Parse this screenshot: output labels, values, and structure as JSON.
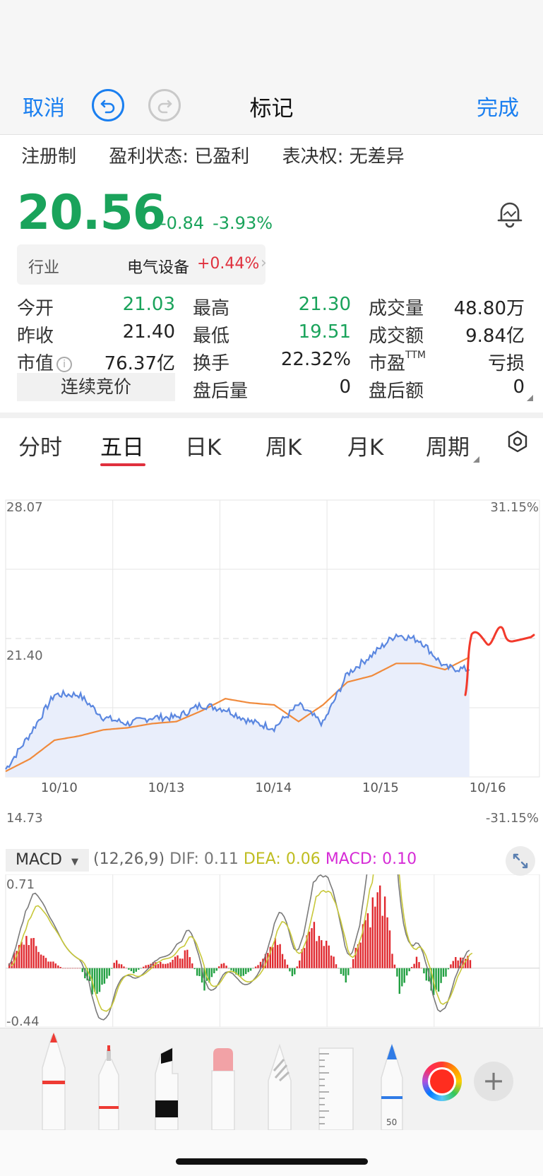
{
  "nav": {
    "cancel": "取消",
    "title": "标记",
    "done": "完成",
    "undo_icon": "undo-icon",
    "redo_icon": "redo-icon"
  },
  "badges": [
    "注册制",
    "盈利状态: 已盈利",
    "表决权: 无差异"
  ],
  "quote": {
    "price": "20.56",
    "change": "-0.84",
    "change_pct": "-3.93%",
    "alert_icon": "bell-icon"
  },
  "industry": {
    "label": "行业",
    "name": "电气设备",
    "change": "+0.44%"
  },
  "stats": {
    "open_label": "今开",
    "open": "21.03",
    "high_label": "最高",
    "high": "21.30",
    "volume_label": "成交量",
    "volume": "48.80万",
    "prev_close_label": "昨收",
    "prev_close": "21.40",
    "low_label": "最低",
    "low": "19.51",
    "turnover_label": "成交额",
    "turnover": "9.84亿",
    "mktcap_label": "市值",
    "mktcap": "76.37亿",
    "turnover_rate_label": "换手",
    "turnover_rate": "22.32%",
    "pe_label": "市盈",
    "pe_sup": "TTM",
    "pe": "亏损",
    "auction_label": "连续竞价",
    "after_vol_label": "盘后量",
    "after_vol": "0",
    "after_amt_label": "盘后额",
    "after_amt": "0"
  },
  "tabs": [
    "分时",
    "五日",
    "日K",
    "周K",
    "月K",
    "周期"
  ],
  "active_tab": "五日",
  "chart_data": [
    {
      "type": "line",
      "x": [
        "10/10",
        "10/13",
        "10/14",
        "10/15",
        "10/16"
      ],
      "ylim": [
        14.73,
        28.07
      ],
      "reference_line": 21.4,
      "left_axis_labels": [
        "28.07",
        "21.40",
        "14.73"
      ],
      "right_axis_labels": [
        "31.15%",
        "-31.15%"
      ],
      "series": [
        {
          "values": [
            15.1,
            16.8,
            18.7,
            18.7,
            17.6,
            17.3,
            17.6,
            17.6,
            18.2,
            18.0,
            17.4,
            17.1,
            18.2,
            17.3,
            19.7,
            20.6,
            21.6,
            21.3,
            20.0,
            19.9
          ]
        },
        {
          "values": [
            15.0,
            15.6,
            16.5,
            16.7,
            17.0,
            17.1,
            17.3,
            17.4,
            17.9,
            18.5,
            18.3,
            18.2,
            17.4,
            18.2,
            19.3,
            19.6,
            20.2,
            20.2,
            19.9,
            20.5
          ]
        }
      ],
      "annotations": [
        "hand-drawn red stroke after 10/16"
      ]
    },
    {
      "type": "bar",
      "title": "MACD",
      "params": "(12,26,9)",
      "dif_label": "DIF: 0.11",
      "dea_label": "DEA: 0.06",
      "macd_label": "MACD: 0.10",
      "ylim": [
        -0.44,
        0.71
      ],
      "axis_labels": [
        "0.71",
        "-0.44"
      ],
      "macd_values": [
        0.05,
        0.3,
        0.1,
        0.0,
        0.0,
        -0.3,
        0.08,
        -0.05,
        0.06,
        0.05,
        0.15,
        -0.2,
        0.06,
        -0.1,
        0.03,
        0.3,
        -0.1,
        0.4,
        0.2,
        -0.15,
        0.45,
        0.7,
        -0.2,
        0.1,
        -0.3,
        0.08,
        0.1
      ],
      "colors": {
        "positive": "#e0282e",
        "negative": "#22a042",
        "dif": "#7a7a7a",
        "dea": "#c8c83a"
      }
    }
  ],
  "macd_selector": "MACD",
  "tools": {
    "pen_icon": "pen-icon",
    "fineliner_icon": "fineliner-icon",
    "marker_icon": "marker-icon",
    "eraser_icon": "eraser-icon",
    "lasso_icon": "lasso-icon",
    "ruler_icon": "ruler-icon",
    "pencil_icon": "pencil-icon",
    "pencil_width": "50",
    "color": "#ff2d1f",
    "add_label": "+"
  }
}
